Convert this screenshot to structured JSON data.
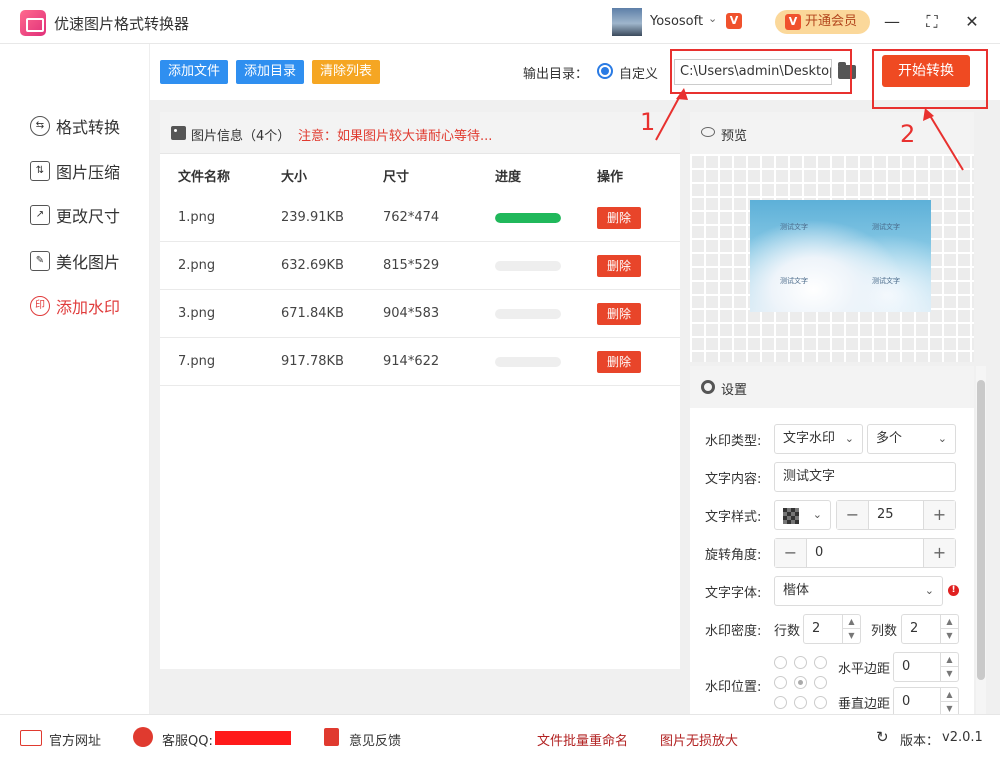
{
  "app": {
    "title": "优速图片格式转换器"
  },
  "user": {
    "name": "Yososoft",
    "vip_label": "开通会员",
    "vip_badge": "V"
  },
  "sidebar": {
    "items": [
      {
        "label": "格式转换",
        "icon": "convert-icon"
      },
      {
        "label": "图片压缩",
        "icon": "compress-icon"
      },
      {
        "label": "更改尺寸",
        "icon": "resize-icon"
      },
      {
        "label": "美化图片",
        "icon": "beautify-icon"
      },
      {
        "label": "添加水印",
        "icon": "watermark-icon",
        "active": true
      }
    ]
  },
  "toolbar": {
    "add_file": "添加文件",
    "add_dir": "添加目录",
    "clear_list": "清除列表",
    "output_label": "输出目录：",
    "radio_label": "自定义",
    "output_path": "C:\\Users\\admin\\Desktop",
    "start_label": "开始转换",
    "annotation_1": "1",
    "annotation_2": "2"
  },
  "file_panel": {
    "title": "图片信息（4个）",
    "note": "注意：如果图片较大请耐心等待...",
    "columns": [
      "文件名称",
      "大小",
      "尺寸",
      "进度",
      "操作"
    ],
    "rows": [
      {
        "name": "1.png",
        "size": "239.91KB",
        "dims": "762*474",
        "progress": 1.0,
        "action": "删除"
      },
      {
        "name": "2.png",
        "size": "632.69KB",
        "dims": "815*529",
        "progress": 0.0,
        "action": "删除"
      },
      {
        "name": "3.png",
        "size": "671.84KB",
        "dims": "904*583",
        "progress": 0.0,
        "action": "删除"
      },
      {
        "name": "7.png",
        "size": "917.78KB",
        "dims": "914*622",
        "progress": 0.0,
        "action": "删除"
      }
    ]
  },
  "preview": {
    "title": "预览",
    "watermark_text": "测试文字"
  },
  "settings": {
    "title": "设置",
    "type_label": "水印类型:",
    "type_value": "文字水印",
    "count_value": "多个",
    "content_label": "文字内容:",
    "content_value": "测试文字",
    "style_label": "文字样式:",
    "size_value": "25",
    "rotate_label": "旋转角度:",
    "rotate_value": "0",
    "font_label": "文字字体:",
    "font_value": "楷体",
    "density_label": "水印密度:",
    "rows_label": "行数",
    "rows_value": "2",
    "cols_label": "列数",
    "cols_value": "2",
    "position_label": "水印位置:",
    "hmargin_label": "水平边距",
    "hmargin_value": "0",
    "vmargin_label": "垂直边距",
    "vmargin_value": "0"
  },
  "footer": {
    "website": "官方网址",
    "qq": "客服QQ:",
    "feedback": "意见反馈",
    "rename": "文件批量重命名",
    "enlarge": "图片无损放大",
    "version_label": "版本：",
    "version": "v2.0.1"
  },
  "colors": {
    "accent": "#ef4a22",
    "blue": "#2a7be4",
    "active": "#e03c3c",
    "progress": "#20b85b"
  }
}
